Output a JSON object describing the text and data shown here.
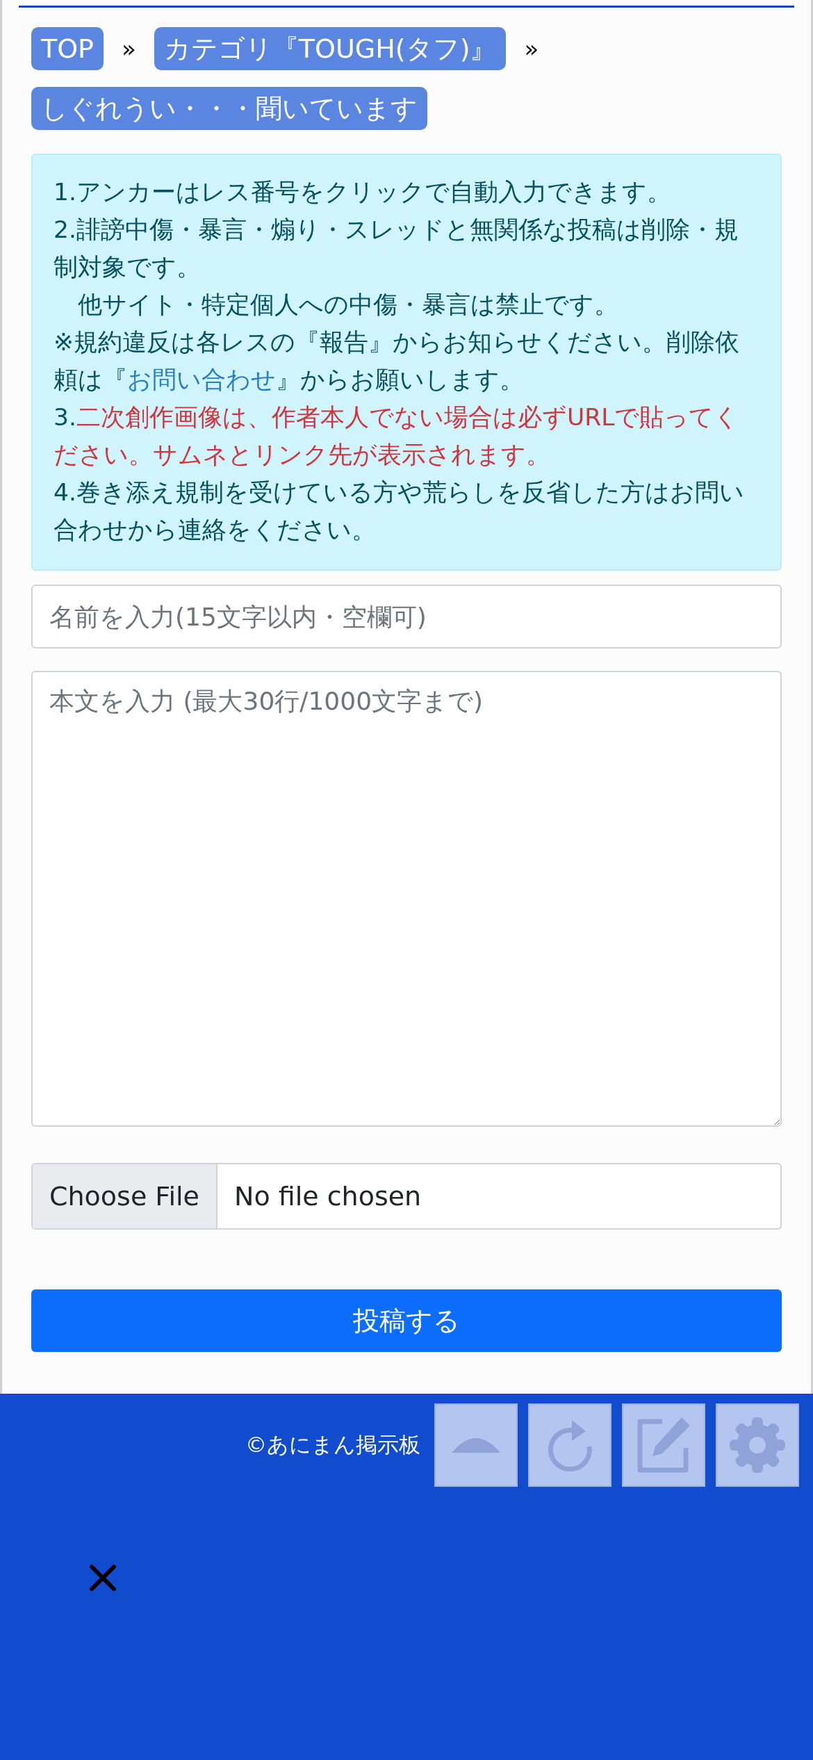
{
  "breadcrumbs": [
    {
      "label": "TOP"
    },
    {
      "label": "カテゴリ『TOUGH(タフ)』"
    },
    {
      "label": "しぐれうい・・・聞いています"
    }
  ],
  "breadcrumb_separator": "»",
  "notice": [
    {
      "parts": [
        {
          "kind": "plain",
          "text": "1.アンカーはレス番号をクリックで自動入力できます。"
        }
      ]
    },
    {
      "parts": [
        {
          "kind": "plain",
          "text": "2.誹謗中傷・暴言・煽り・スレッドと無関係な投稿は削除・規制対象です。"
        }
      ]
    },
    {
      "parts": [
        {
          "kind": "plain",
          "text": "　他サイト・特定個人への中傷・暴言は禁止です。"
        }
      ]
    },
    {
      "parts": [
        {
          "kind": "plain",
          "text": "※規約違反は各レスの『報告』からお知らせください。削除依頼は『"
        },
        {
          "kind": "link",
          "text": "お問い合わせ"
        },
        {
          "kind": "plain",
          "text": "』からお願いします。"
        }
      ]
    },
    {
      "parts": [
        {
          "kind": "plain",
          "text": "3."
        },
        {
          "kind": "warning",
          "text": "二次創作画像は、作者本人でない場合は必ずURLで貼ってください。サムネとリンク先が表示されます。"
        }
      ]
    },
    {
      "parts": [
        {
          "kind": "plain",
          "text": "4.巻き添え規制を受けている方や荒らしを反省した方はお問い合わせから連絡をください。"
        }
      ]
    }
  ],
  "name_field": {
    "placeholder": "名前を入力(15文字以内・空欄可)"
  },
  "body_field": {
    "placeholder": "本文を入力 (最大30行/1000文字まで)"
  },
  "file_field": {
    "button": "Choose File",
    "status": "No file chosen"
  },
  "submit_button": "投稿する",
  "footer": {
    "copyright": "©あにまん掲示板"
  }
}
